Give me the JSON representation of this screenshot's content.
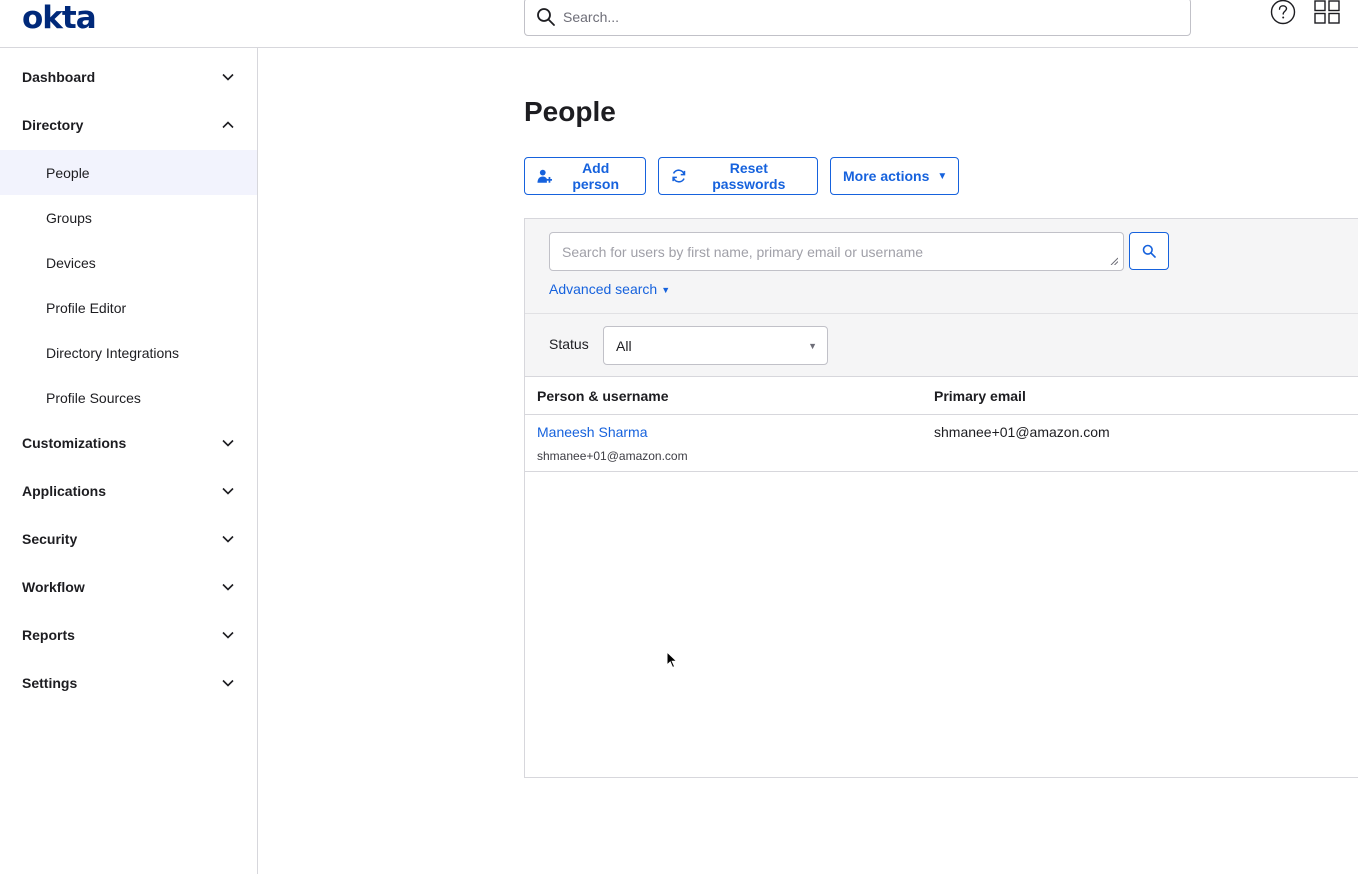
{
  "header": {
    "logo": "okta",
    "search_placeholder": "Search..."
  },
  "sidebar": {
    "sections": [
      {
        "label": "Dashboard",
        "expanded": false
      },
      {
        "label": "Directory",
        "expanded": true
      },
      {
        "label": "Customizations",
        "expanded": false
      },
      {
        "label": "Applications",
        "expanded": false
      },
      {
        "label": "Security",
        "expanded": false
      },
      {
        "label": "Workflow",
        "expanded": false
      },
      {
        "label": "Reports",
        "expanded": false
      },
      {
        "label": "Settings",
        "expanded": false
      }
    ],
    "directory_items": [
      {
        "label": "People",
        "active": true
      },
      {
        "label": "Groups"
      },
      {
        "label": "Devices"
      },
      {
        "label": "Profile Editor"
      },
      {
        "label": "Directory Integrations"
      },
      {
        "label": "Profile Sources"
      }
    ]
  },
  "main": {
    "title": "People",
    "actions": {
      "add_person": "Add person",
      "reset_passwords": "Reset passwords",
      "more_actions": "More actions"
    },
    "search": {
      "placeholder": "Search for users by first name, primary email or username",
      "advanced_label": "Advanced search"
    },
    "filter": {
      "status_label": "Status",
      "status_value": "All"
    },
    "table": {
      "columns": [
        "Person & username",
        "Primary email"
      ],
      "rows": [
        {
          "name": "Maneesh Sharma",
          "username": "shmanee+01@amazon.com",
          "email": "shmanee+01@amazon.com"
        }
      ]
    }
  },
  "colors": {
    "brand": "#00297a",
    "link": "#1662dd",
    "active_bg": "#f2f3fd"
  }
}
